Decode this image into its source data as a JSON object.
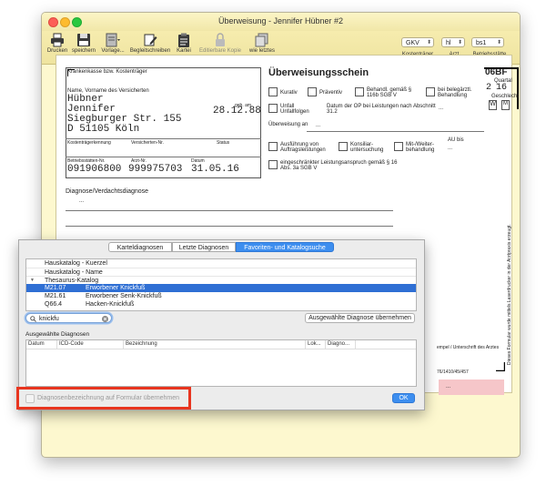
{
  "window": {
    "title": "Überweisung - Jennifer Hübner #2"
  },
  "toolbar": {
    "buttons": [
      {
        "label": "Drucken",
        "icon": "printer-icon",
        "enabled": true
      },
      {
        "label": "speichern",
        "icon": "save-icon",
        "enabled": true
      },
      {
        "label": "Vorlage...",
        "icon": "template-icon",
        "enabled": true
      },
      {
        "label": "Begleitschreiben",
        "icon": "letter-edit-icon",
        "enabled": true
      },
      {
        "label": "Kartei",
        "icon": "clipboard-icon",
        "enabled": true
      },
      {
        "label": "Editierbare Kopie",
        "icon": "lock-icon",
        "enabled": false
      },
      {
        "label": "wie letztes",
        "icon": "copy-icon",
        "enabled": true
      }
    ],
    "selects": [
      {
        "value": "GKV",
        "label": "Kostenträger"
      },
      {
        "value": "hl",
        "label": "Arzt"
      },
      {
        "value": "bs1",
        "label": "Betriebsstätte"
      }
    ]
  },
  "form": {
    "insurer_label": "Krankenkasse bzw. Kostenträger",
    "name_label": "Name, Vorname des Versicherten",
    "last_name": "Hübner",
    "first_name": "Jennifer",
    "birth_label": "geb. am",
    "birth_date": "28.12.88",
    "street": "Siegburger Str. 155",
    "city": "D 51105 Köln",
    "insurer_id_label": "Kostenträgerkennung",
    "insured_no_label": "Versicherten-Nr.",
    "status_label": "Status",
    "bsnr_label": "Betriebsstätten-Nr.",
    "lanr_label": "Arzt-Nr.",
    "date_label": "Datum",
    "bsnr": "091906800",
    "lanr": "999975703",
    "date": "31.05.16",
    "title": "Überweisungsschein",
    "form_code": "06BF",
    "quarter_label": "Quartal",
    "quarter_digits": [
      "2",
      "16"
    ],
    "gender_label": "Geschlecht",
    "gender_value": "W",
    "gender_alt": "M",
    "checkbox_kurativ": "Kurativ",
    "checkbox_praeventiv": "Präventiv",
    "checkbox_116b": "Behandl. gemäß § 116b SGB V",
    "checkbox_belegaerztl": "bei belegärztl. Behandlung",
    "checkbox_unfall": "Unfall Unfallfolgen",
    "op_label": "Datum der OP bei Leistungen nach Abschnitt 31.2",
    "op_value": "...",
    "referral_label": "Überweisung an",
    "referral_value": "...",
    "checkbox_ausfuehrung": "Ausführung von Auftragsleistungen",
    "checkbox_konsiliar": "Konsiliar-untersuchung",
    "checkbox_mitweiter": "Mit-/Weiter-behandlung",
    "au_label": "AU bis",
    "au_value": "...",
    "checkbox_eingeschraenkt": "eingeschränkter Leistungsanspruch gemäß § 16 Abs. 3a SGB V",
    "diagnosis_label": "Diagnose/Verdachtsdiagnose",
    "diagnosis_value": "...",
    "side_note": "Dieses Formular wurde mittels Laserdrucker in der Arztpraxis erzeugt.",
    "signature_label": "empel / Unterschrift des Arztes",
    "form_id": "76/1410/45/457",
    "stamp_value": "..."
  },
  "dialog": {
    "tabs": [
      {
        "label": "Karteldiagnosen",
        "active": false
      },
      {
        "label": "Letzte Diagnosen",
        "active": false
      },
      {
        "label": "Favoriten- und Katalogsuche",
        "active": true
      }
    ],
    "tree_rows": [
      {
        "label": "Hauskatalog - Kuerzel",
        "type": "header",
        "expander": ""
      },
      {
        "label": "Hauskatalog - Name",
        "type": "header",
        "expander": ""
      },
      {
        "label": "Thesaurus-Katalog",
        "type": "header",
        "expander": "▼"
      },
      {
        "code": "M21.07",
        "name": "Erworbener Knickfuß",
        "type": "item",
        "selected": true
      },
      {
        "code": "M21.61",
        "name": "Erworbener Senk-Knickfuß",
        "type": "item",
        "selected": false
      },
      {
        "code": "Q66.4",
        "name": "Hacken-Knickfuß",
        "type": "item",
        "selected": false
      }
    ],
    "search_value": "knickfu",
    "adopt_button": "Ausgewählte Diagnose übernehmen",
    "selected_section_label": "Ausgewählte Diagnosen",
    "columns": [
      "Datum",
      "ICD-Code",
      "Bezeichnung",
      "Lok...",
      "Diagno..."
    ],
    "checkbox_label": "Diagnosenbezeichnung auf Formular übernehmen",
    "ok_button": "OK"
  },
  "colors": {
    "selection": "#2f6fd4",
    "accent_tab": "#3d8eef",
    "highlight": "#e8351f",
    "window_bg": "#fdf8cf"
  }
}
